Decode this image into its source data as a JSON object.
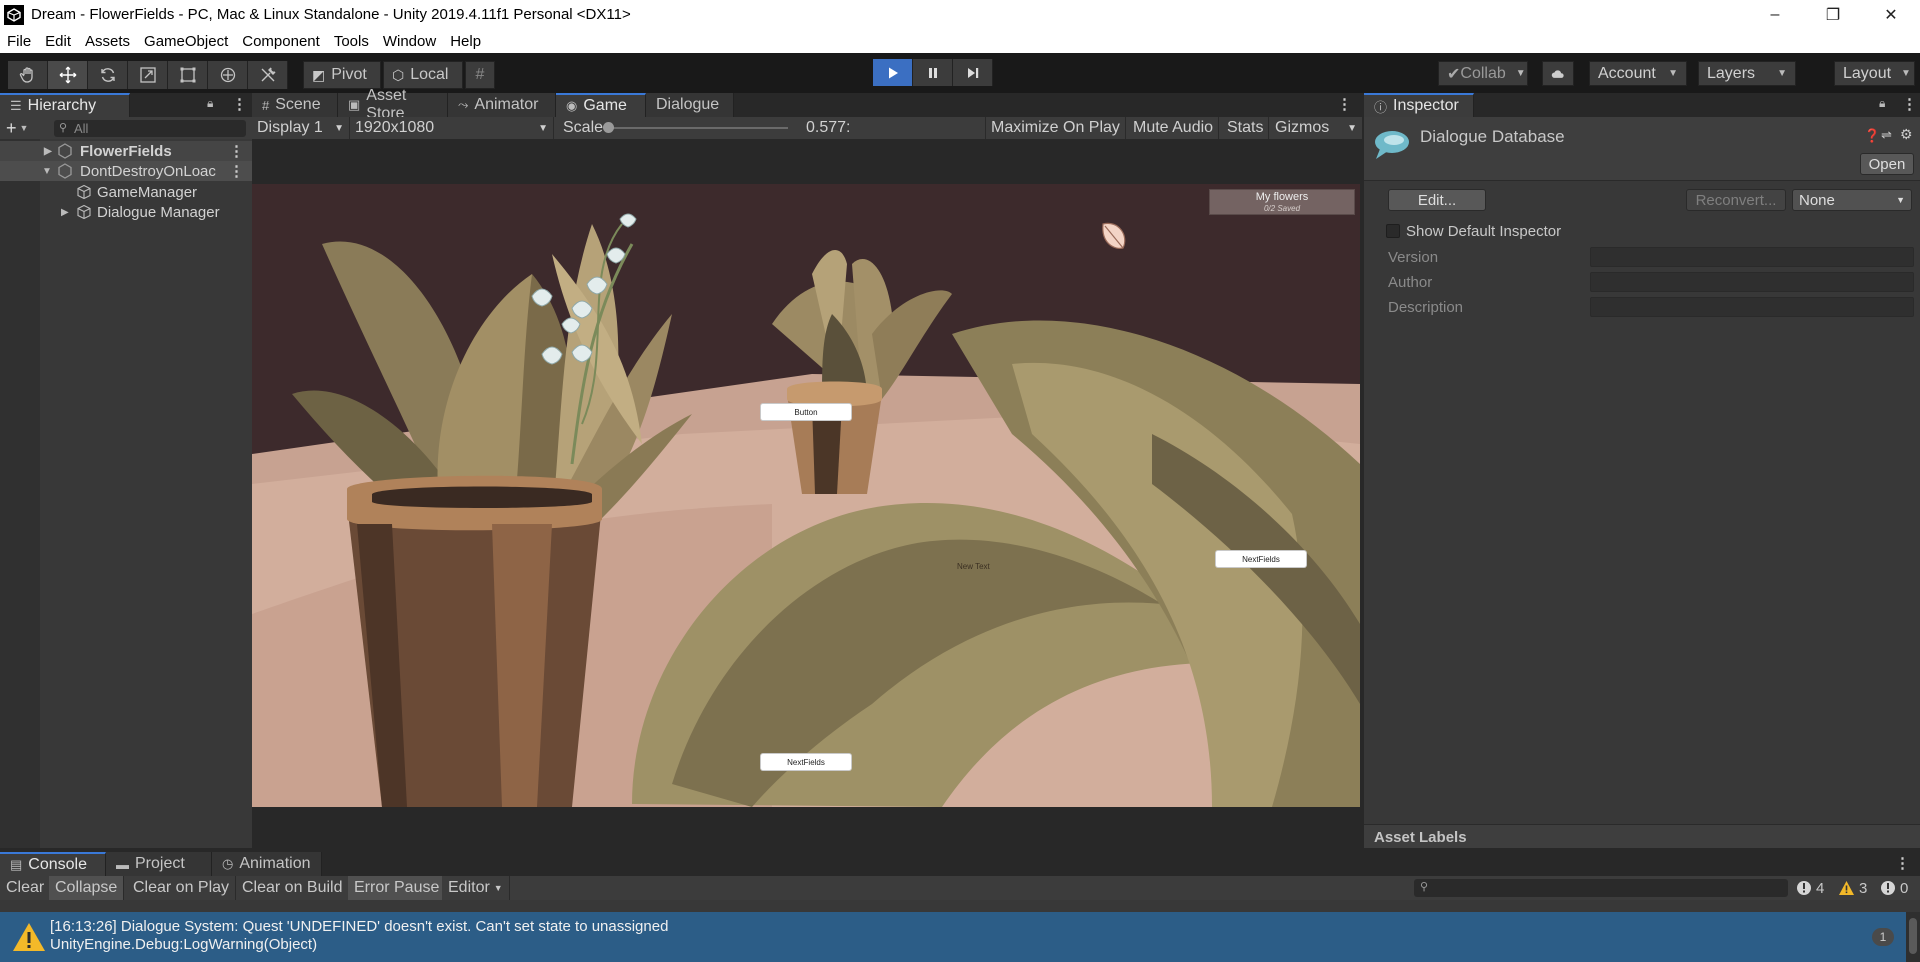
{
  "window": {
    "title": "Dream - FlowerFields - PC, Mac & Linux Standalone - Unity 2019.4.11f1 Personal <DX11>",
    "controls": [
      "–",
      "❐",
      "✕"
    ]
  },
  "menu": [
    "File",
    "Edit",
    "Assets",
    "GameObject",
    "Component",
    "Tools",
    "Window",
    "Help"
  ],
  "toolbar": {
    "pivot_label": "Pivot",
    "local_label": "Local",
    "collab_label": "Collab",
    "account_label": "Account",
    "layers_label": "Layers",
    "layout_label": "Layout"
  },
  "hierarchy": {
    "tab_label": "Hierarchy",
    "search_placeholder": "All",
    "rows": [
      {
        "label": "FlowerFields"
      },
      {
        "label": "DontDestroyOnLoac"
      },
      {
        "label": "GameManager"
      },
      {
        "label": "Dialogue Manager"
      }
    ]
  },
  "center_tabs": [
    {
      "label": "Scene",
      "icon": "hash-icon"
    },
    {
      "label": "Asset Store",
      "icon": "bag-icon"
    },
    {
      "label": "Animator",
      "icon": "animator-icon"
    },
    {
      "label": "Game",
      "icon": "gamepad-icon"
    },
    {
      "label": "Dialogue",
      "icon": ""
    }
  ],
  "game_toolbar": {
    "display": "Display 1",
    "resolution": "1920x1080",
    "scale_label": "Scale",
    "scale_value": "0.577:",
    "maximize": "Maximize On Play",
    "mute": "Mute Audio",
    "stats": "Stats",
    "gizmos": "Gizmos"
  },
  "game_ui": {
    "button_label": "Button",
    "next_fields_right": "NextFields",
    "next_fields_bottom": "NextFields",
    "new_text": "New Text",
    "my_flowers_title": "My flowers",
    "my_flowers_sub": "0/2 Saved"
  },
  "inspector": {
    "tab_label": "Inspector",
    "object_title": "Dialogue Database",
    "open_button": "Open",
    "edit_button": "Edit...",
    "reconvert_button": "Reconvert...",
    "none_dropdown": "None",
    "show_default_label": "Show Default Inspector",
    "fields": [
      "Version",
      "Author",
      "Description"
    ],
    "asset_labels": "Asset Labels"
  },
  "console": {
    "tabs": [
      {
        "label": "Console",
        "icon": "console-icon"
      },
      {
        "label": "Project",
        "icon": "folder-icon"
      },
      {
        "label": "Animation",
        "icon": "clock-icon"
      }
    ],
    "buttons": [
      "Clear",
      "Collapse",
      "Clear on Play",
      "Clear on Build",
      "Error Pause",
      "Editor"
    ],
    "info_count": "4",
    "warn_count": "3",
    "error_count": "0",
    "log_line1": "[16:13:26] Dialogue System: Quest 'UNDEFINED' doesn't exist. Can't set state to unassigned",
    "log_line2": "UnityEngine.Debug:LogWarning(Object)",
    "log_count": "1"
  },
  "colors": {
    "accent": "#3a79d8",
    "play_active": "#3b6fc2",
    "log_highlight": "#2c5d87",
    "warning": "#f3b929"
  }
}
